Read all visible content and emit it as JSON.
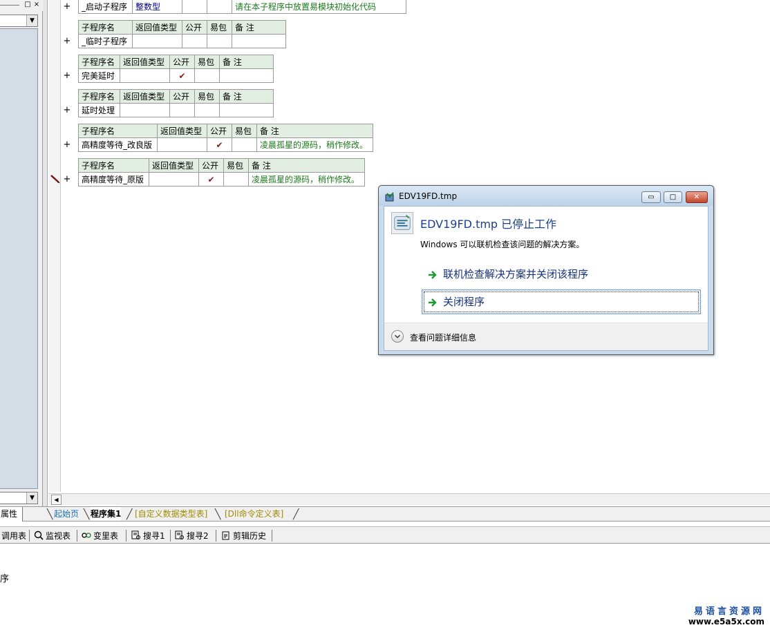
{
  "left_panel": {
    "tab_label": "属性",
    "title_buttons": [
      "□",
      "×"
    ]
  },
  "tables": [
    {
      "header": null,
      "row": [
        "_启动子程序",
        "整数型",
        "",
        "",
        "请在本子程序中放置易模块初始化代码"
      ]
    },
    {
      "header": [
        "子程序名",
        "返回值类型",
        "公开",
        "易包",
        "备 注"
      ],
      "row": [
        "_临时子程序",
        "",
        "",
        "",
        ""
      ]
    },
    {
      "header": [
        "子程序名",
        "返回值类型",
        "公开",
        "易包",
        "备 注"
      ],
      "row": [
        "完美延时",
        "",
        "✔",
        "",
        ""
      ]
    },
    {
      "header": [
        "子程序名",
        "返回值类型",
        "公开",
        "易包",
        "备 注"
      ],
      "row": [
        "延时处理",
        "",
        "",
        "",
        ""
      ]
    },
    {
      "header": [
        "子程序名",
        "返回值类型",
        "公开",
        "易包",
        "备 注"
      ],
      "row": [
        "高精度等待_改良版",
        "",
        "✔",
        "",
        "凌晨孤星的源码，稍作修改。"
      ]
    },
    {
      "header": [
        "子程序名",
        "返回值类型",
        "公开",
        "易包",
        "备 注"
      ],
      "row": [
        "高精度等待_原版",
        "",
        "✔",
        "",
        "凌晨孤星的源码，稍作修改。"
      ]
    }
  ],
  "expand_symbol": "+",
  "tabs": {
    "home": "起始页",
    "program_set": "程序集1",
    "user_types": "[自定义数据类型表]",
    "dll_commands": "[Dll命令定义表]"
  },
  "bottom_toolbar": {
    "call_table": "调用表",
    "watch": "监视表",
    "variables": "变里表",
    "search1": "搜寻1",
    "search2": "搜寻2",
    "clip_history": "剪辑历史"
  },
  "output_pane": {
    "text": "序"
  },
  "dialog": {
    "title": "EDV19FD.tmp",
    "heading": "EDV19FD.tmp 已停止工作",
    "subtext": "Windows 可以联机检查该问题的解决方案。",
    "option_check": "联机检查解决方案并关闭该程序",
    "option_close": "关闭程序",
    "details": "查看问题详细信息",
    "win_min": "▭",
    "win_max": "□",
    "win_close": "✕"
  },
  "watermark": {
    "cn": "易语言资源网",
    "url": "www.e5a5x.com"
  },
  "colors": {
    "header_bg": "#e3eee3",
    "comment_green": "#1a7a1a",
    "dialog_heading_blue": "#1b3f8f",
    "check_red": "#8b1a1a"
  }
}
